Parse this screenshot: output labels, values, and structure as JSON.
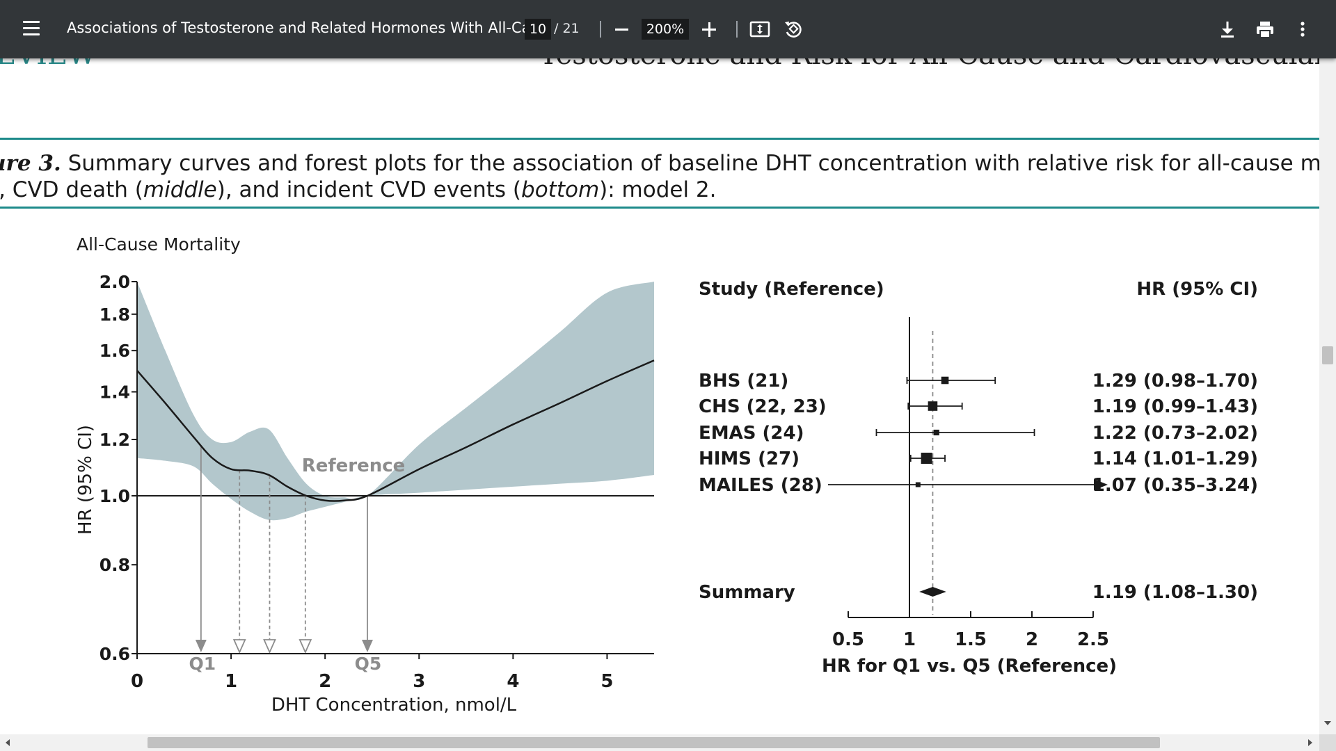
{
  "toolbar": {
    "title": "Associations of Testosterone and Related Hormones With All-Ca...",
    "page_current": "10",
    "page_total": "/ 21",
    "zoom": "200%"
  },
  "page": {
    "running_head_left": "EVIEW",
    "running_head_right": "Testosterone and Risk for All-Cause and Cardiovascular Mortality in",
    "caption_line1_label": "ure 3.",
    "caption_line1_text": " Summary curves and forest plots for the association of baseline DHT concentration with relative risk for all-cause mor",
    "caption_line2_a": "), CVD death (",
    "caption_line2_b": "middle",
    "caption_line2_c": "), and incident CVD events (",
    "caption_line2_d": "bottom",
    "caption_line2_e": "): model 2."
  },
  "colors": {
    "toolbar_bg": "#323639",
    "accent_teal": "#1d8a8a",
    "ci_band": "#b3c7cc",
    "reference_gray": "#8c8c8c"
  },
  "chart_data": [
    {
      "type": "line",
      "title": "All-Cause Mortality",
      "xlabel": "DHT Concentration, nmol/L",
      "ylabel": "HR (95% CI)",
      "xlim": [
        0,
        5.5
      ],
      "ylim": [
        0.6,
        2.0
      ],
      "yscale": "log",
      "xticks": [
        0,
        1,
        2,
        3,
        4,
        5
      ],
      "yticks": [
        0.6,
        0.8,
        1.0,
        1.2,
        1.4,
        1.6,
        1.8,
        2.0
      ],
      "ytick_labels": [
        "0.6",
        "0.8",
        "1.0",
        "1.2",
        "1.4",
        "1.6",
        "1.8",
        "2.0"
      ],
      "reference_line": 1.0,
      "annotation": "Reference",
      "quintile_labels": [
        "Q1",
        "Q5"
      ],
      "quintile_markers": [
        0.68,
        1.09,
        1.41,
        1.79,
        2.45
      ],
      "series": [
        {
          "x": [
            0,
            0.3,
            0.6,
            0.8,
            1.0,
            1.2,
            1.4,
            1.6,
            1.8,
            2.0,
            2.2,
            2.45,
            3.0,
            3.5,
            4.0,
            4.5,
            5.0,
            5.5
          ],
          "y": [
            1.5,
            1.35,
            1.21,
            1.13,
            1.09,
            1.085,
            1.07,
            1.03,
            1.0,
            0.985,
            0.985,
            1.0,
            1.09,
            1.17,
            1.26,
            1.35,
            1.45,
            1.55
          ],
          "lower": [
            1.13,
            1.12,
            1.1,
            1.04,
            0.99,
            0.95,
            0.925,
            0.93,
            0.95,
            0.965,
            0.98,
            1.0,
            1.01,
            1.02,
            1.03,
            1.04,
            1.05,
            1.07
          ],
          "upper": [
            2.0,
            1.6,
            1.3,
            1.2,
            1.19,
            1.23,
            1.24,
            1.13,
            1.04,
            1.0,
            0.995,
            1.0,
            1.18,
            1.33,
            1.5,
            1.7,
            1.93,
            2.0
          ]
        }
      ]
    },
    {
      "type": "forest",
      "xlabel": "HR for Q1 vs. Q5 (Reference)",
      "xlim": [
        0.5,
        2.5
      ],
      "xticks": [
        0.5,
        1,
        1.5,
        2,
        2.5
      ],
      "null_value": 1,
      "summary_line": 1.19,
      "col_study_header": "Study (Reference)",
      "col_hr_header": "HR (95% CI)",
      "studies": [
        {
          "label": "BHS (21)",
          "hr": 1.29,
          "lo": 0.98,
          "hi": 1.7,
          "text": "1.29 (0.98–1.70)",
          "weight": 0.55
        },
        {
          "label": "CHS (22, 23)",
          "hr": 1.19,
          "lo": 0.99,
          "hi": 1.43,
          "text": "1.19 (0.99–1.43)",
          "weight": 0.8
        },
        {
          "label": "EMAS (24)",
          "hr": 1.22,
          "lo": 0.73,
          "hi": 2.02,
          "text": "1.22 (0.73–2.02)",
          "weight": 0.35
        },
        {
          "label": "HIMS (27)",
          "hr": 1.14,
          "lo": 1.01,
          "hi": 1.29,
          "text": "1.14 (1.01–1.29)",
          "weight": 1.0
        },
        {
          "label": "MAILES (28)",
          "hr": 1.07,
          "lo": 0.35,
          "hi": 3.24,
          "text": "1.07 (0.35–3.24)",
          "weight": 0.25
        }
      ],
      "summary": {
        "label": "Summary",
        "hr": 1.19,
        "lo": 1.08,
        "hi": 1.3,
        "text": "1.19 (1.08–1.30)"
      }
    }
  ]
}
